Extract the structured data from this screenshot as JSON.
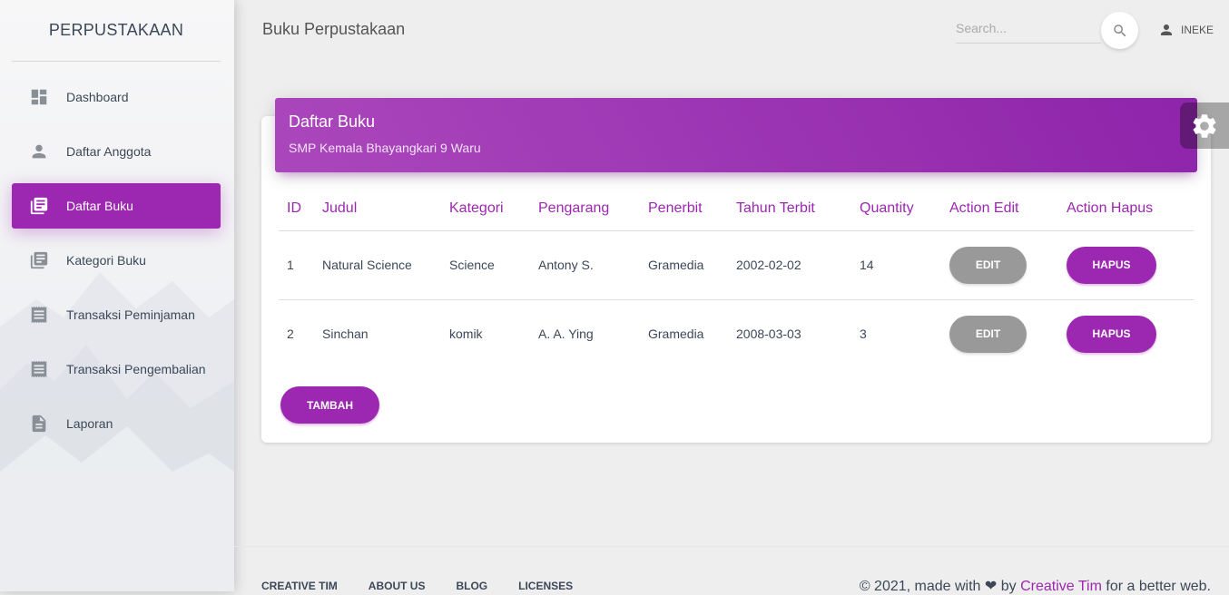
{
  "sidebar": {
    "brand": "PERPUSTAKAAN",
    "items": [
      {
        "label": "Dashboard",
        "icon": "dashboard-icon"
      },
      {
        "label": "Daftar Anggota",
        "icon": "person-icon"
      },
      {
        "label": "Daftar Buku",
        "icon": "library-books-icon",
        "active": true
      },
      {
        "label": "Kategori Buku",
        "icon": "library-books-icon"
      },
      {
        "label": "Transaksi Peminjaman",
        "icon": "receipt-icon"
      },
      {
        "label": "Transaksi Pengembalian",
        "icon": "receipt-icon"
      },
      {
        "label": "Laporan",
        "icon": "description-icon"
      }
    ]
  },
  "navbar": {
    "title": "Buku Perpustakaan",
    "search_placeholder": "Search...",
    "user": "INEKE"
  },
  "card": {
    "title": "Daftar Buku",
    "subtitle": "SMP Kemala Bhayangkari 9 Waru",
    "columns": [
      "ID",
      "Judul",
      "Kategori",
      "Pengarang",
      "Penerbit",
      "Tahun Terbit",
      "Quantity",
      "Action Edit",
      "Action Hapus"
    ],
    "rows": [
      {
        "id": "1",
        "judul": "Natural Science",
        "kategori": "Science",
        "pengarang": "Antony S.",
        "penerbit": "Gramedia",
        "tahun": "2002-02-02",
        "qty": "14"
      },
      {
        "id": "2",
        "judul": "Sinchan",
        "kategori": "komik",
        "pengarang": "A. A. Ying",
        "penerbit": "Gramedia",
        "tahun": "2008-03-03",
        "qty": "3"
      }
    ],
    "edit_label": "EDIT",
    "hapus_label": "HAPUS",
    "tambah_label": "TAMBAH"
  },
  "footer": {
    "links": [
      "CREATIVE TIM",
      "ABOUT US",
      "BLOG",
      "LICENSES"
    ],
    "copyright_prefix": "© 2021, made with",
    "copyright_by": "by",
    "copyright_link": "Creative Tim",
    "copyright_suffix": "for a better web."
  },
  "colors": {
    "primary": "#9c27b0",
    "edit_button": "#999999",
    "background": "#eeeeee"
  }
}
